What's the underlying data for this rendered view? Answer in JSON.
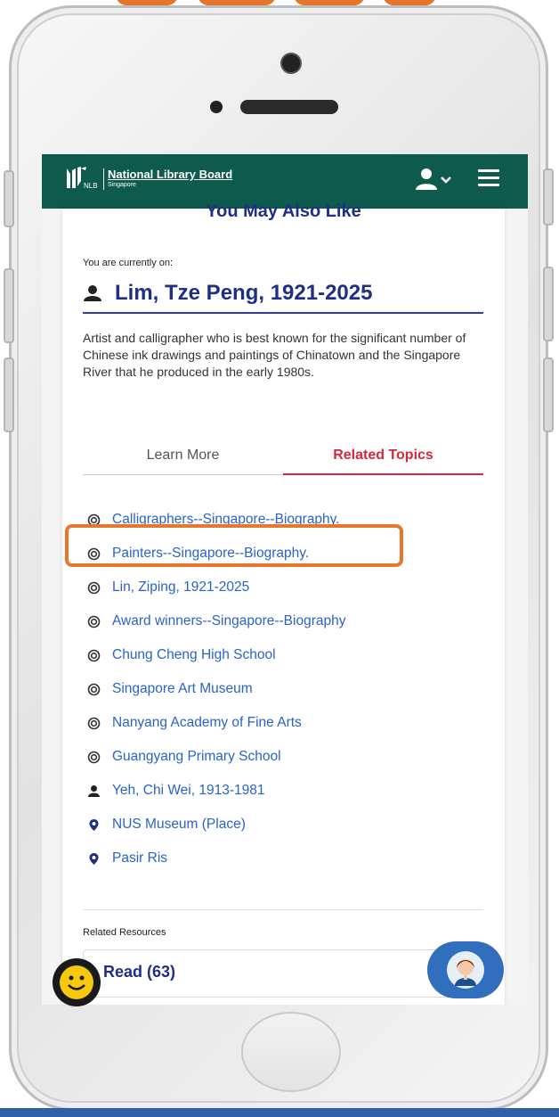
{
  "header": {
    "logo_small": "NLB",
    "org_name": "National Library Board",
    "org_country": "Singapore"
  },
  "card": {
    "title": "You May Also Like",
    "current_label": "You are currently on:",
    "current_name": "Lim, Tze Peng, 1921-2025",
    "description": "Artist and calligrapher who is best known for the significant number of Chinese ink drawings and paintings of Chinatown and the Singapore River that he produced in the early 1980s."
  },
  "tabs": [
    {
      "label": "Learn More",
      "active": false
    },
    {
      "label": "Related Topics",
      "active": true
    }
  ],
  "topics": [
    {
      "label": "Calligraphers--Singapore--Biography.",
      "icon": "subject-icon"
    },
    {
      "label": "Painters--Singapore--Biography.",
      "icon": "subject-icon"
    },
    {
      "label": "Lin, Ziping, 1921-2025",
      "icon": "subject-icon"
    },
    {
      "label": "Award winners--Singapore--Biography",
      "icon": "subject-icon"
    },
    {
      "label": "Chung Cheng High School",
      "icon": "subject-icon"
    },
    {
      "label": "Singapore Art Museum",
      "icon": "subject-icon"
    },
    {
      "label": "Nanyang Academy of Fine Arts",
      "icon": "subject-icon"
    },
    {
      "label": "Guangyang Primary School",
      "icon": "subject-icon"
    },
    {
      "label": "Yeh, Chi Wei, 1913-1981",
      "icon": "person-icon"
    },
    {
      "label": "NUS Museum (Place)",
      "icon": "location-pin-icon"
    },
    {
      "label": "Pasir Ris",
      "icon": "location-pin-icon"
    }
  ],
  "resources": {
    "label": "Related Resources",
    "read_label": "Read (63)"
  },
  "colors": {
    "navbar": "#0e5a4d",
    "title_blue": "#1f2f86",
    "link_blue": "#2a63c7",
    "active_tab_red": "#d8273b",
    "highlight_orange": "#e9762d"
  }
}
